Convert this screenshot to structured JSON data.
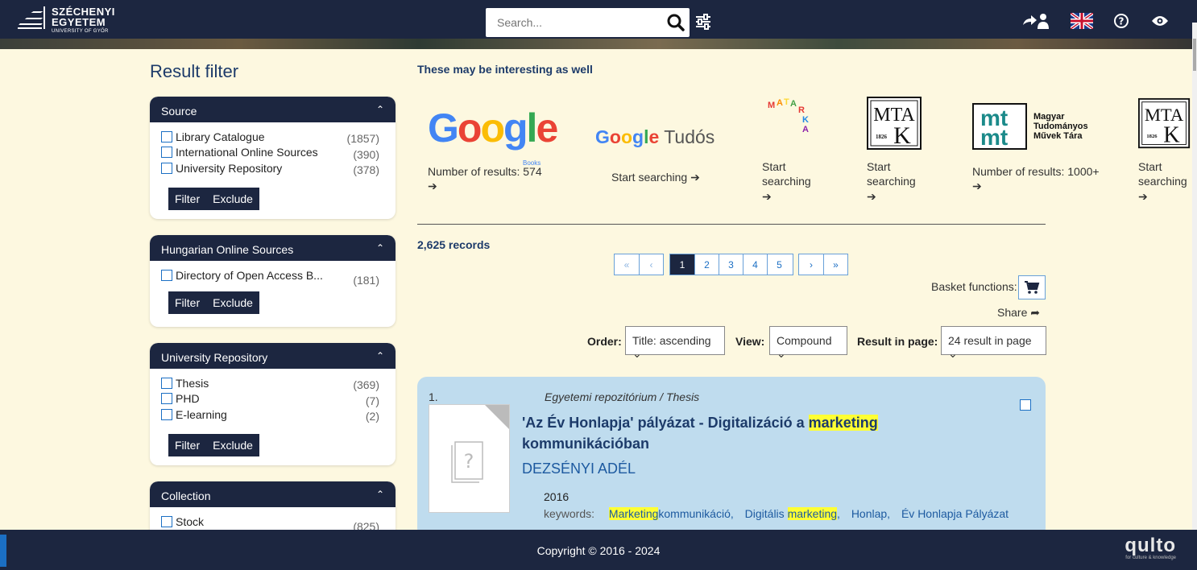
{
  "header": {
    "logo": {
      "line1": "SZÉCHENYI",
      "line2": "EGYETEM",
      "line3": "UNIVERSITY OF GYŐR"
    },
    "search_placeholder": "Search...",
    "icons": [
      "login-icon",
      "language-flag-icon",
      "help-icon",
      "accessibility-eye-icon"
    ]
  },
  "sidebar": {
    "title": "Result filter",
    "panels": [
      {
        "title": "Source",
        "items": [
          {
            "label": "Library Catalogue",
            "count": "(1857)"
          },
          {
            "label": "International Online Sources",
            "count": "(390)"
          },
          {
            "label": "University Repository",
            "count": "(378)"
          }
        ]
      },
      {
        "title": "Hungarian Online Sources",
        "items": [
          {
            "label": "Directory of Open Access B...",
            "count": "(181)"
          }
        ]
      },
      {
        "title": "University Repository",
        "items": [
          {
            "label": "Thesis",
            "count": "(369)"
          },
          {
            "label": "PHD",
            "count": "(7)"
          },
          {
            "label": "E-learning",
            "count": "(2)"
          }
        ]
      },
      {
        "title": "Collection",
        "items": [
          {
            "label": "Stock",
            "count": "(825)"
          }
        ]
      }
    ],
    "filter_label": "Filter",
    "exclude_label": "Exclude"
  },
  "interesting": {
    "title": "These may be interesting as well",
    "sources": [
      {
        "logo": "Google",
        "logo_sub": "Books",
        "text": "Number of results: 574"
      },
      {
        "logo": "Google Tudós",
        "text": "Start searching"
      },
      {
        "logo": "MATARKA",
        "text": "Start searching"
      },
      {
        "logo": "MTA K",
        "logo_year": "1826",
        "text": "Start searching"
      },
      {
        "logo": "mt mt",
        "logo_caption": "Magyar Tudományos Művek Tára",
        "text": "Number of results: 1000+"
      },
      {
        "logo": "MTA K",
        "logo_year": "1826",
        "text": "Start searching"
      }
    ]
  },
  "results": {
    "records": "2,625 records",
    "pager": {
      "first": "«",
      "prev": "‹",
      "pages": [
        "1",
        "2",
        "3",
        "4",
        "5"
      ],
      "current": "1",
      "next": "›",
      "last": "»"
    },
    "basket_label": "Basket functions:",
    "share_label": "Share",
    "order_label": "Order:",
    "order_value": "Title: ascending",
    "view_label": "View:",
    "view_value": "Compound",
    "rip_label": "Result in page:",
    "rip_value": "24 result in page",
    "item": {
      "number": "1.",
      "type": "Egyetemi repozitórium / Thesis",
      "title_pre": "'Az Év Honlapja' pályázat - Digitalizáció a ",
      "title_hl": "marketing",
      "title_post": " kommunikációban",
      "author": "DEZSÉNYI ADÉL",
      "year": "2016",
      "keywords_label": "keywords:",
      "kw1_hl": "Marketing",
      "kw1_rest": "kommunikáció,",
      "kw2_pre": "Digitális ",
      "kw2_hl": "marketing",
      "kw2_post": ",",
      "kw3": "Honlap,",
      "kw4": "Év Honlapja Pályázat"
    }
  },
  "footer": {
    "copyright": "Copyright © 2016 - 2024",
    "brand": "qulto",
    "brand_tagline": "for culture & knowledge"
  },
  "colors": {
    "navy": "#1c2640",
    "background": "#fdf8e0",
    "card": "#bfdcee",
    "highlight": "#ffff33",
    "accent": "#1b6fc4"
  }
}
